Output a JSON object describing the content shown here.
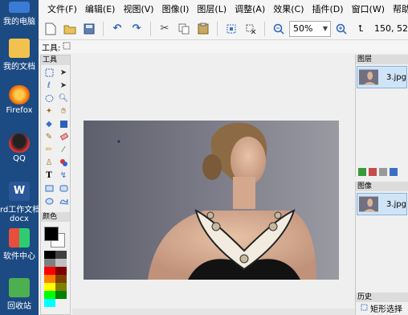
{
  "desktop": {
    "icons": [
      {
        "label": "我的电脑",
        "icon": "computer-icon"
      },
      {
        "label": "我的文档",
        "icon": "documents-folder-icon"
      },
      {
        "label": "Firefox",
        "icon": "firefox-icon"
      },
      {
        "label": "QQ",
        "icon": "qq-penguin-icon"
      },
      {
        "label": "rd工作文档",
        "label2": "docx",
        "icon": "word-doc-icon"
      },
      {
        "label": "软件中心",
        "icon": "software-center-icon"
      },
      {
        "label": "回收站",
        "icon": "recycle-bin-icon"
      }
    ]
  },
  "menubar": {
    "items": [
      "文件(F)",
      "编辑(E)",
      "视图(V)",
      "图像(I)",
      "图层(L)",
      "调整(A)",
      "效果(C)",
      "插件(D)",
      "窗口(W)",
      "帮助(H)"
    ]
  },
  "toolbar": {
    "zoom_value": "50%",
    "coords": "150, 52",
    "tool_label": "工具:"
  },
  "tools_panel": {
    "title": "工具",
    "tools": [
      "rect-select-icon",
      "move-selection-icon",
      "lasso-select-icon",
      "move-selected-icon",
      "ellipse-select-icon",
      "zoom-icon",
      "magic-wand-icon",
      "pan-hand-icon",
      "paint-bucket-icon",
      "gradient-icon",
      "paintbrush-icon",
      "eraser-icon",
      "pencil-icon",
      "color-picker-icon",
      "clone-stamp-icon",
      "recolor-icon",
      "text-icon",
      "line-curve-icon",
      "rectangle-shape-icon",
      "rounded-rect-icon",
      "ellipse-shape-icon",
      "freeform-shape-icon"
    ],
    "colors_title": "颜色"
  },
  "colors": {
    "primary": "#000000",
    "secondary": "#ffffff",
    "palette": [
      "#000000",
      "#404040",
      "#808080",
      "#c0c0c0",
      "#ff0000",
      "#800000",
      "#ff8000",
      "#804000",
      "#ffff00",
      "#808000",
      "#00ff00",
      "#008000",
      "#00ffff"
    ]
  },
  "layers_panel": {
    "title": "图层",
    "layer_name": "3.jpg"
  },
  "image_panel": {
    "title": "图像",
    "image_name": "3.jpg"
  },
  "history_panel": {
    "title": "历史",
    "item": "矩形选择"
  }
}
